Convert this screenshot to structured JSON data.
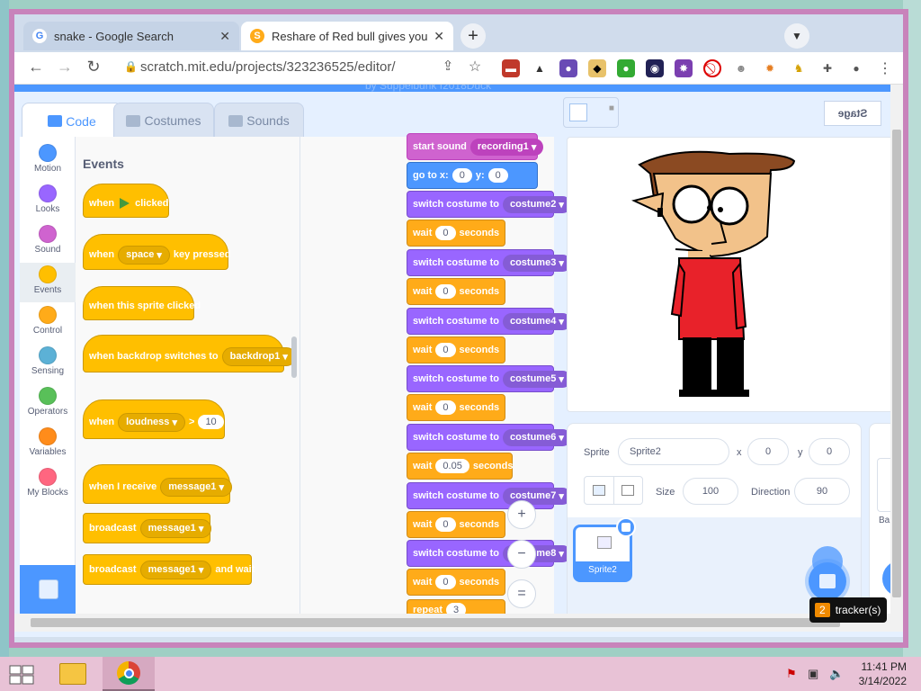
{
  "browser": {
    "tabs": [
      {
        "title": "snake - Google Search",
        "favicon": "G",
        "active": false
      },
      {
        "title": "Reshare of Red bull gives you wi",
        "favicon": "S",
        "active": true
      }
    ],
    "url": "scratch.mit.edu/projects/323236525/editor/"
  },
  "scratch": {
    "menubar_text": "by Suppelbunk  f2018Duck",
    "editor_tabs": [
      "Code",
      "Costumes",
      "Sounds"
    ],
    "categories": [
      {
        "label": "Motion",
        "color": "#4c97ff"
      },
      {
        "label": "Looks",
        "color": "#9966ff"
      },
      {
        "label": "Sound",
        "color": "#cf63cf"
      },
      {
        "label": "Events",
        "color": "#ffbf00"
      },
      {
        "label": "Control",
        "color": "#ffab19"
      },
      {
        "label": "Sensing",
        "color": "#5cb1d6"
      },
      {
        "label": "Operators",
        "color": "#59c059"
      },
      {
        "label": "Variables",
        "color": "#ff8c1a"
      },
      {
        "label": "My Blocks",
        "color": "#ff6680"
      }
    ],
    "palette": {
      "title": "Events",
      "when": "when",
      "clicked": "clicked",
      "space": "space",
      "key_pressed": "key pressed",
      "when_sprite_clicked": "when this sprite clicked",
      "when_backdrop": "when backdrop switches to",
      "backdrop1": "backdrop1",
      "loudness": "loudness",
      "gt": ">",
      "ten": "10",
      "when_i_receive": "when I receive",
      "message1": "message1",
      "broadcast": "broadcast",
      "and_wait": "and wait"
    },
    "script": {
      "start_sound": "start sound",
      "recording1": "recording1",
      "go_to_x": "go to x:",
      "x_val": "0",
      "y_label": "y:",
      "y_val": "0",
      "switch_costume": "switch costume to",
      "wait": "wait",
      "seconds": "seconds",
      "zero": "0",
      "wait_short": "0.05",
      "costumes": [
        "costume2",
        "costume3",
        "costume4",
        "costume5",
        "costume6",
        "costume7",
        "costume8"
      ],
      "repeat": "repeat",
      "repeat_val": "3"
    },
    "zoom": {
      "in": "+",
      "out": "−",
      "reset": "="
    },
    "stage_header": {
      "mirrored_label": "Stage"
    },
    "sprite_info": {
      "sprite_label": "Sprite",
      "sprite_name": "Sprite2",
      "x_label": "x",
      "x_val": "0",
      "y_label": "y",
      "y_val": "0",
      "size_label": "Size",
      "size_val": "100",
      "direction_label": "Direction",
      "direction_val": "90"
    },
    "sprite_list": [
      {
        "name": "Sprite2",
        "selected": true
      }
    ],
    "stage_pane_label": "Ba"
  },
  "tracker": {
    "count": "2",
    "label": "tracker(s)"
  },
  "taskbar": {
    "time": "11:41 PM",
    "date": "3/14/2022"
  }
}
